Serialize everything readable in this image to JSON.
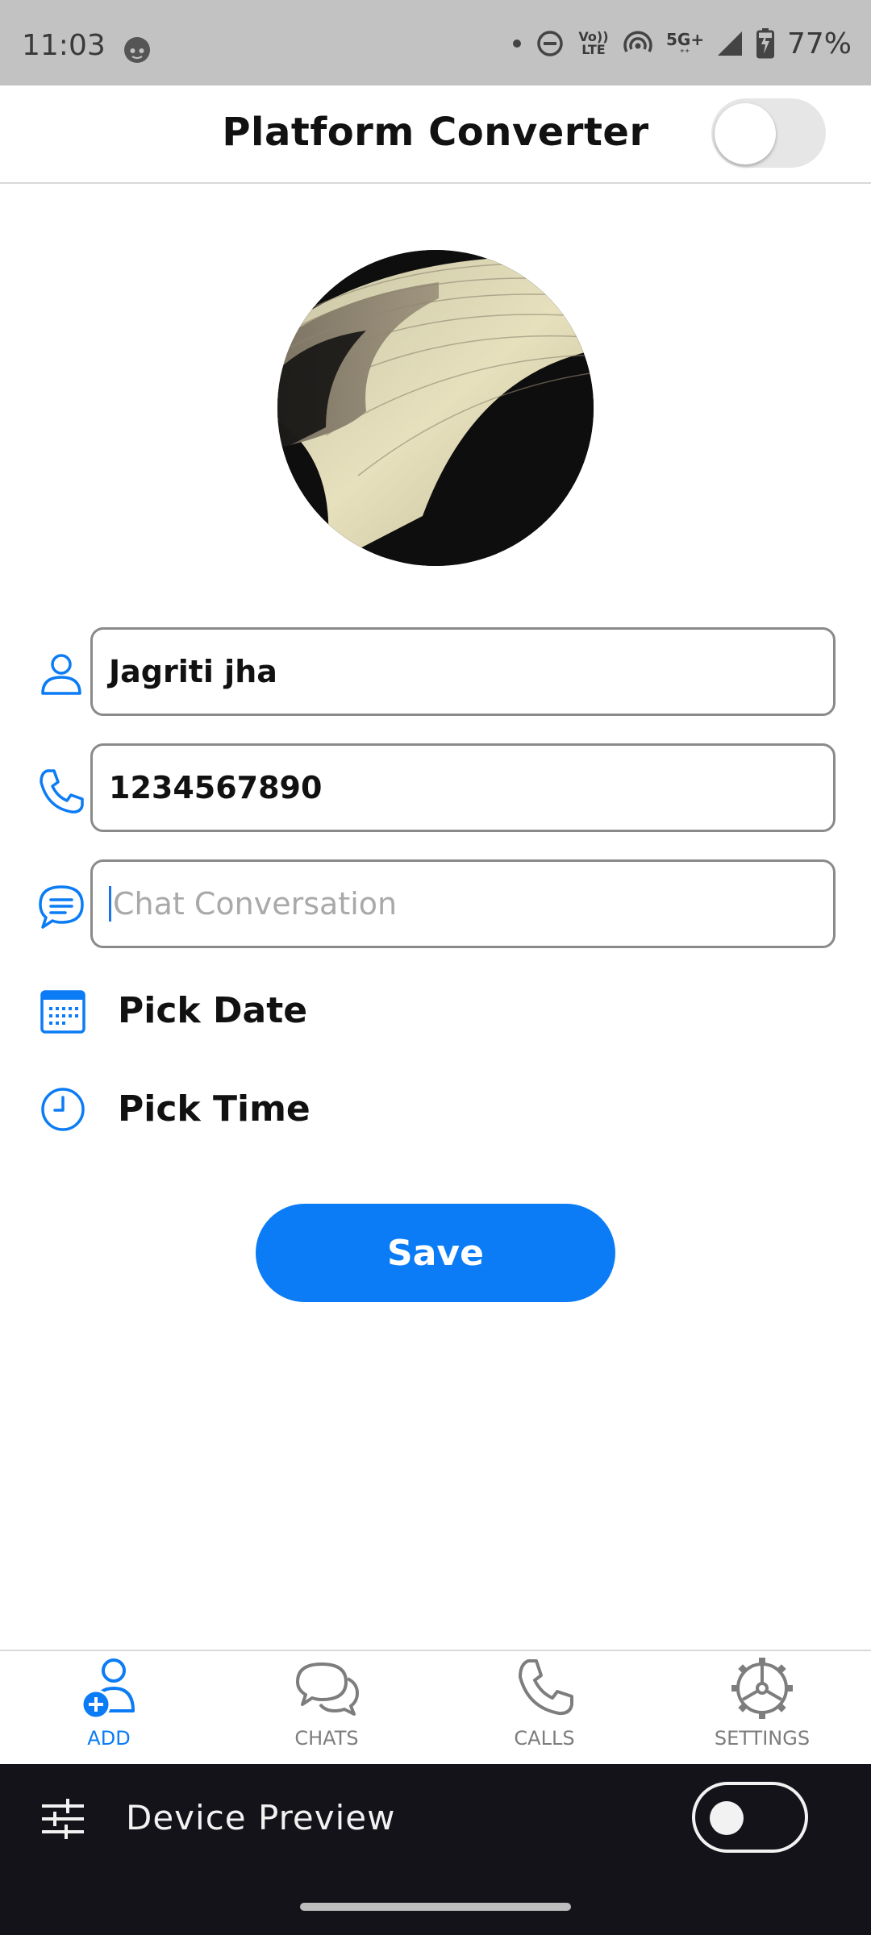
{
  "status_bar": {
    "time": "11:03",
    "volte_top": "Vo))",
    "volte_bottom": "LTE",
    "network": "5G+",
    "battery": "77%"
  },
  "appbar": {
    "title": "Platform Converter",
    "theme_switch_on": false
  },
  "form": {
    "name_value": "Jagriti jha",
    "phone_value": "1234567890",
    "chat_placeholder": "Chat Conversation",
    "pick_date_label": "Pick Date",
    "pick_time_label": "Pick Time",
    "save_label": "Save"
  },
  "bottom_nav": {
    "items": [
      {
        "label": "ADD",
        "icon": "add-person-icon",
        "active": true
      },
      {
        "label": "CHATS",
        "icon": "chat-bubbles-icon",
        "active": false
      },
      {
        "label": "CALLS",
        "icon": "phone-icon",
        "active": false
      },
      {
        "label": "SETTINGS",
        "icon": "gear-icon",
        "active": false
      }
    ]
  },
  "device_preview": {
    "label": "Device Preview",
    "switch_on": false
  },
  "colors": {
    "accent": "#0b7cf5",
    "status_bar_bg": "#c2c2c2",
    "device_bar_bg": "#14131a"
  }
}
